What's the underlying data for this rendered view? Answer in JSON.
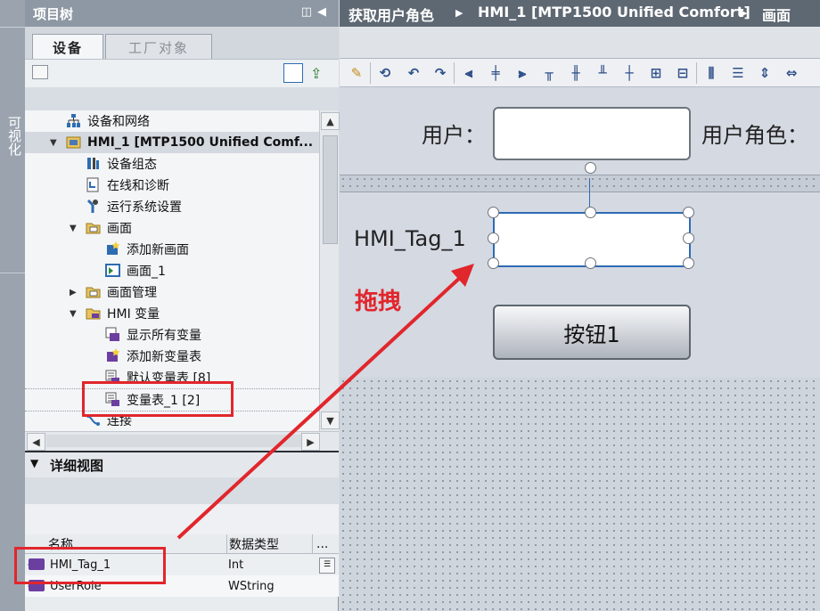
{
  "left_strip": {
    "label": "可视化"
  },
  "project_tree": {
    "title": "项目树",
    "tabs": [
      "设备",
      "工厂对象"
    ],
    "items": [
      {
        "label": "设备和网络",
        "icon": "network-icon"
      },
      {
        "label": "HMI_1 [MTP1500 Unified Comf...",
        "icon": "hmi-folder-icon"
      },
      {
        "label": "设备组态",
        "icon": "device-config-icon"
      },
      {
        "label": "在线和诊断",
        "icon": "diagnostics-icon"
      },
      {
        "label": "运行系统设置",
        "icon": "runtime-settings-icon"
      },
      {
        "label": "画面",
        "icon": "folder-icon"
      },
      {
        "label": "添加新画面",
        "icon": "add-screen-icon"
      },
      {
        "label": "画面_1",
        "icon": "screen-icon"
      },
      {
        "label": "画面管理",
        "icon": "folder-icon"
      },
      {
        "label": "HMI 变量",
        "icon": "folder-icon"
      },
      {
        "label": "显示所有变量",
        "icon": "show-tags-icon"
      },
      {
        "label": "添加新变量表",
        "icon": "add-tag-table-icon"
      },
      {
        "label": "默认变量表 [8]",
        "icon": "tag-table-icon"
      },
      {
        "label": "变量表_1 [2]",
        "icon": "tag-table-icon"
      },
      {
        "label": "连接",
        "icon": "connection-icon"
      }
    ]
  },
  "detail_view": {
    "title": "详细视图",
    "columns": [
      "名称",
      "数据类型",
      "..."
    ],
    "rows": [
      {
        "name": "HMI_Tag_1",
        "type": "Int"
      },
      {
        "name": "UserRole",
        "type": "WString"
      }
    ]
  },
  "editor": {
    "breadcrumb": [
      "获取用户角色",
      "HMI_1 [MTP1500 Unified Comfort]",
      "画面"
    ],
    "user_label": "用户：",
    "user_role_label": "用户角色：",
    "tag_label": "HMI_Tag_1",
    "button_label": "按钮1"
  },
  "annotation": {
    "drag_text": "拖拽",
    "color": "#e1262c"
  }
}
